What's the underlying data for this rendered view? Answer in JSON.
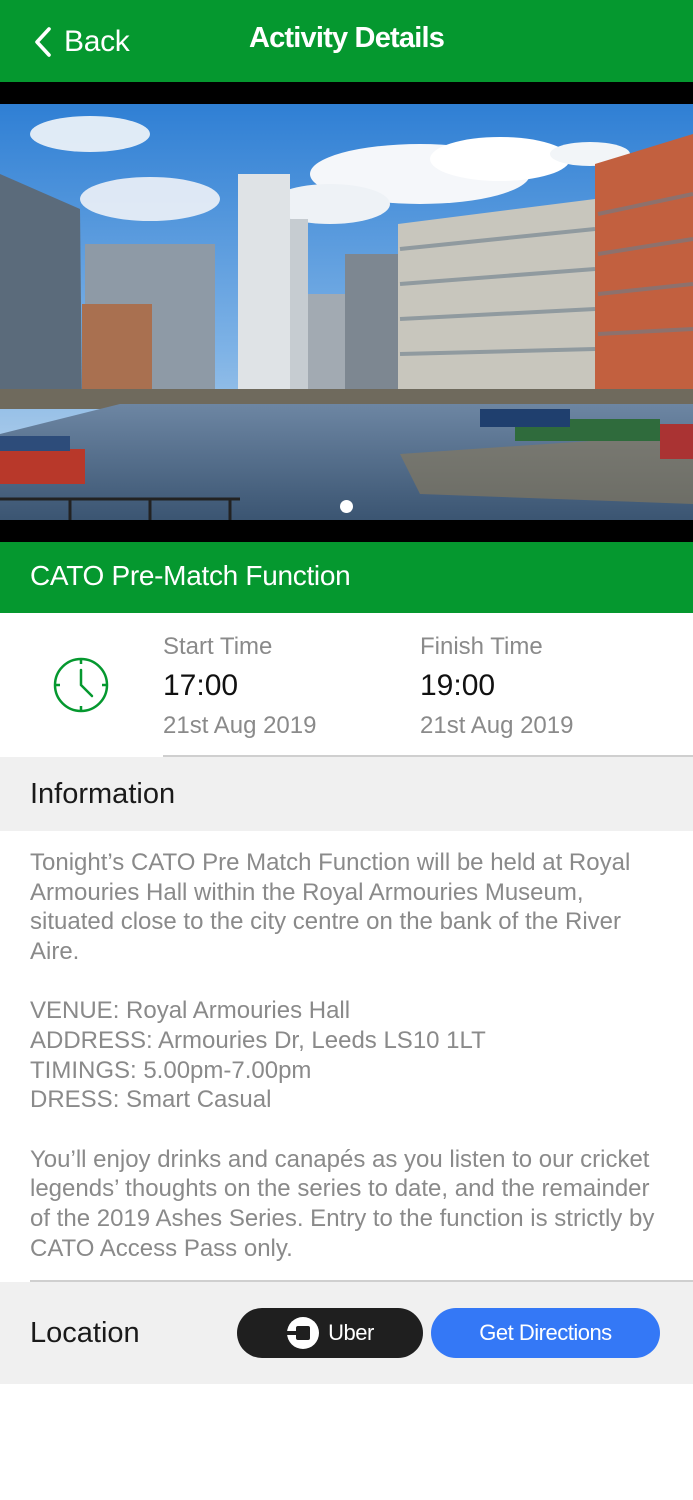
{
  "nav": {
    "back_label": "Back",
    "title": "Activity Details",
    "bg_color": "#05982f"
  },
  "hero": {
    "image_subject": "canal with boats and modern apartment buildings",
    "carousel_total": 1,
    "carousel_active_index": 0
  },
  "event": {
    "title": "CATO Pre-Match Function"
  },
  "times": {
    "clock_icon": "clock-icon",
    "start": {
      "label": "Start Time",
      "time": "17:00",
      "date": "21st Aug 2019"
    },
    "finish": {
      "label": "Finish Time",
      "time": "19:00",
      "date": "21st Aug 2019"
    }
  },
  "information": {
    "heading": "Information",
    "paragraph1": "Tonight’s CATO Pre Match Function will be held at Royal Armouries Hall within the Royal Armouries Museum, situated close to the city centre on the bank of the River Aire.",
    "venue": "VENUE: Royal Armouries Hall",
    "address": "ADDRESS: Armouries Dr, Leeds LS10 1LT",
    "timings": "TIMINGS: 5.00pm-7.00pm",
    "dress": "DRESS: Smart Casual",
    "paragraph2": "You’ll enjoy drinks and canapés as you listen to our cricket legends’ thoughts on the series to date, and the remainder of the 2019 Ashes Series.  Entry to the function is strictly by CATO Access Pass only."
  },
  "location": {
    "heading": "Location",
    "uber_label": "Uber",
    "directions_label": "Get Directions",
    "uber_color": "#1f1f1f",
    "directions_color": "#3478f6"
  }
}
